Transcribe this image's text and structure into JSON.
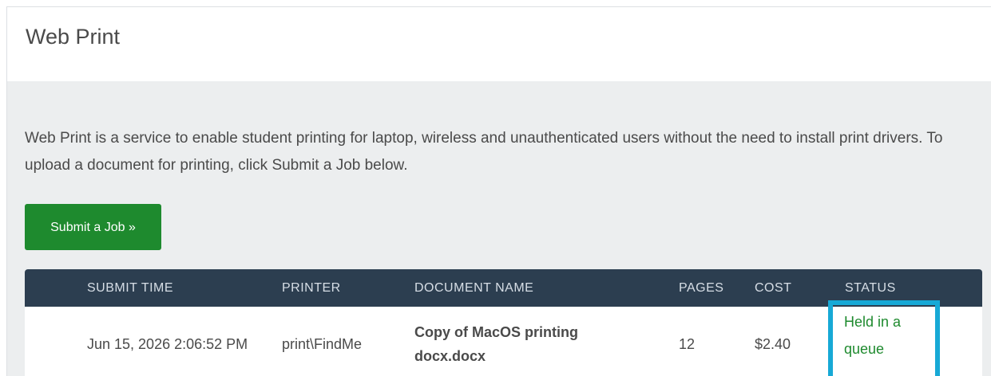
{
  "card": {
    "title": "Web Print",
    "intro": "Web Print is a service to enable student printing for laptop, wireless and unauthenticated users without the need to install print drivers. To upload a document for printing, click Submit a Job below.",
    "submit_label": "Submit a Job »"
  },
  "table": {
    "headers": {
      "submit_time": "SUBMIT TIME",
      "printer": "PRINTER",
      "document_name": "DOCUMENT NAME",
      "pages": "PAGES",
      "cost": "COST",
      "status": "STATUS"
    },
    "rows": [
      {
        "submit_time": "Jun 15, 2026 2:06:52 PM",
        "printer": "print\\FindMe",
        "document_name": "Copy of MacOS printing docx.docx",
        "pages": "12",
        "cost": "$2.40",
        "status": "Held in a queue"
      }
    ]
  },
  "colors": {
    "header_bg": "#2c3e50",
    "button_bg": "#1e8a2e",
    "status_text": "#1e8a2e",
    "highlight_border": "#17a9d6",
    "body_bg": "#eceeef"
  }
}
